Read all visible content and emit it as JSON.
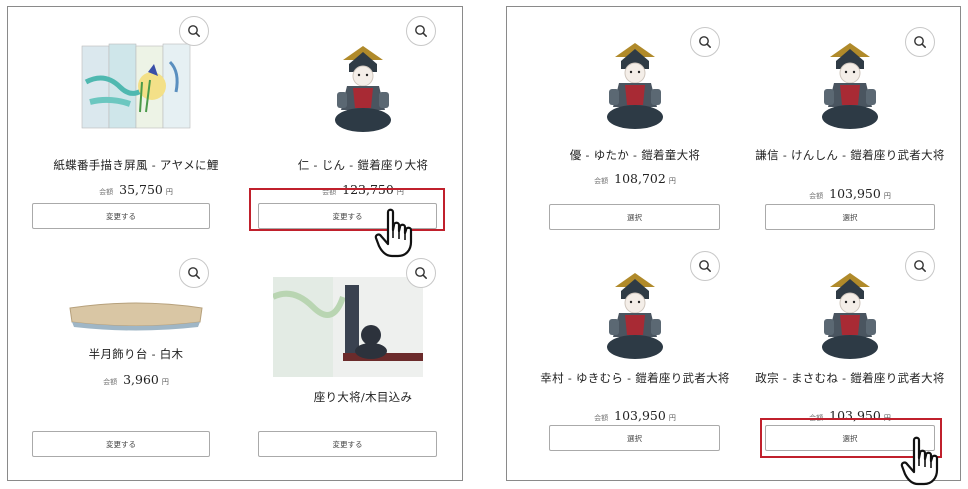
{
  "left_panel": {
    "products": [
      {
        "name": "紙蝶番手描き屏風 - アヤメに鯉",
        "tax_label": "会額",
        "price": "35,750",
        "currency": "円",
        "button": "変更する",
        "image": "folding-screen-iris-carp"
      },
      {
        "name": "仁 - じん - 鎧着座り大将",
        "tax_label": "会額",
        "price": "123,750",
        "currency": "円",
        "button": "変更する",
        "image": "samurai-doll-jin"
      },
      {
        "name": "半月飾り台 - 白木",
        "tax_label": "会額",
        "price": "3,960",
        "currency": "円",
        "button": "変更する",
        "image": "half-moon-stand-white-wood"
      },
      {
        "name": "座り大将/木目込み",
        "button": "変更する",
        "image": "seated-general-kimekomi-photo"
      }
    ]
  },
  "right_panel": {
    "products": [
      {
        "name": "優 - ゆたか - 鎧着童大将",
        "tax_label": "会額",
        "price": "108,702",
        "currency": "円",
        "button": "選択",
        "image": "samurai-doll-yutaka"
      },
      {
        "name": "謙信 - けんしん - 鎧着座り武者大将",
        "tax_label": "会額",
        "price": "103,950",
        "currency": "円",
        "button": "選択",
        "image": "samurai-doll-kenshin"
      },
      {
        "name": "幸村 - ゆきむら - 鎧着座り武者大将",
        "tax_label": "会額",
        "price": "103,950",
        "currency": "円",
        "button": "選択",
        "image": "samurai-doll-yukimura"
      },
      {
        "name": "政宗 - まさむね - 鎧着座り武者大将",
        "tax_label": "会額",
        "price": "103,950",
        "currency": "円",
        "button": "選択",
        "image": "samurai-doll-masamune"
      }
    ]
  },
  "icons": {
    "zoom": "zoom-icon",
    "cursor": "pointing-hand-cursor-icon"
  },
  "colors": {
    "highlight": "#c0202c",
    "border": "#8a8a8a"
  }
}
